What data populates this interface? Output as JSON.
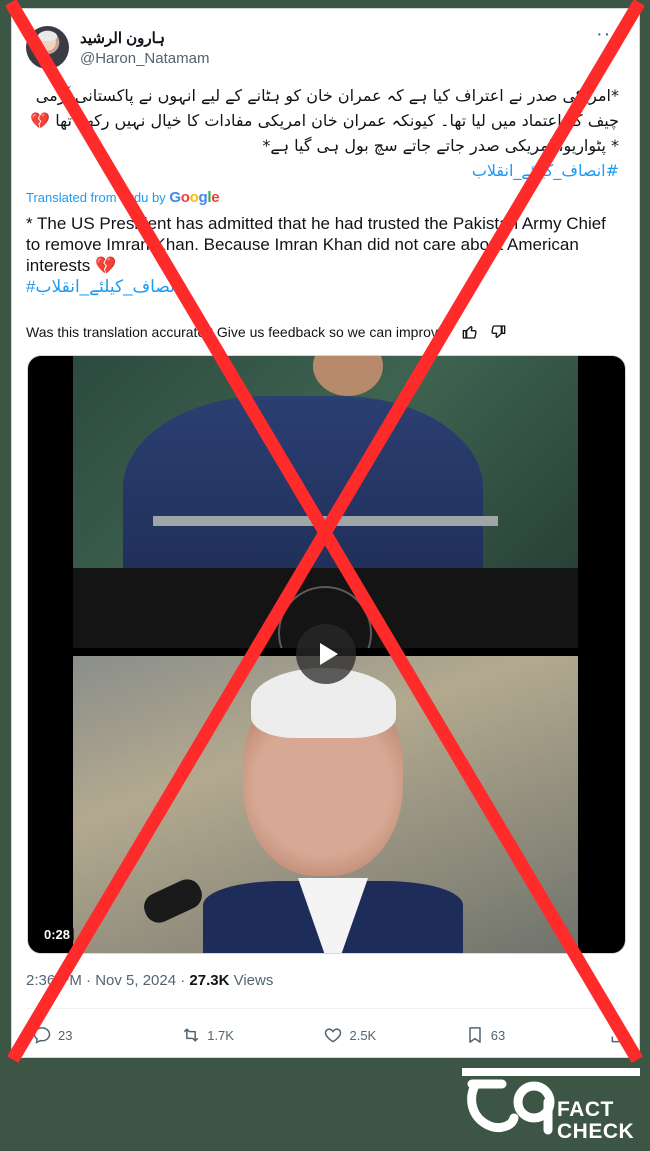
{
  "author": {
    "display_name": "ہارون الرشید",
    "handle": "@Haron_Natamam"
  },
  "more_label": "···",
  "tweet": {
    "urdu_lines": [
      "*امریکی صدر نے اعتراف کیا ہے کہ عمران خان کو ہٹانے کے لیے انہوں نے پاکستانی آرمی",
      "چیف کو اعتماد میں لیا تھا۔ کیونکہ عمران خان امریکی مفادات کا خیال نہیں رکھتا تھا",
      "* پٹواریو، امریکی صدر جاتے جاتے سچ بول ہی گیا ہے*"
    ],
    "urdu_emoji": "💔",
    "urdu_hashtag": "#انصاف_کیلئے_انقلاب",
    "translated_label": "Translated from Urdu by",
    "translator": "Google",
    "english_text": "* The US President has admitted that he had trusted the Pakistan Army Chief to remove Imran Khan. Because Imran Khan did not care about American interests",
    "english_emoji": "💔",
    "english_hashtag": "#انصاف_کیلئے_انقلاب",
    "feedback_text": "Was this translation accurate? Give us feedback so we can improve:"
  },
  "video": {
    "duration": "0:28"
  },
  "meta": {
    "time": "2:36 PM · Nov 5, 2024 · ",
    "views_count": "27.3K",
    "views_label": " Views"
  },
  "actions": {
    "replies": "23",
    "reposts": "1.7K",
    "likes": "2.5K",
    "bookmarks": "63"
  },
  "logo": {
    "line1": "FACT",
    "line2": "CHECK"
  },
  "colors": {
    "background": "#3d5544",
    "accent": "#1d9bf0",
    "cross": "#ff2b2b"
  }
}
